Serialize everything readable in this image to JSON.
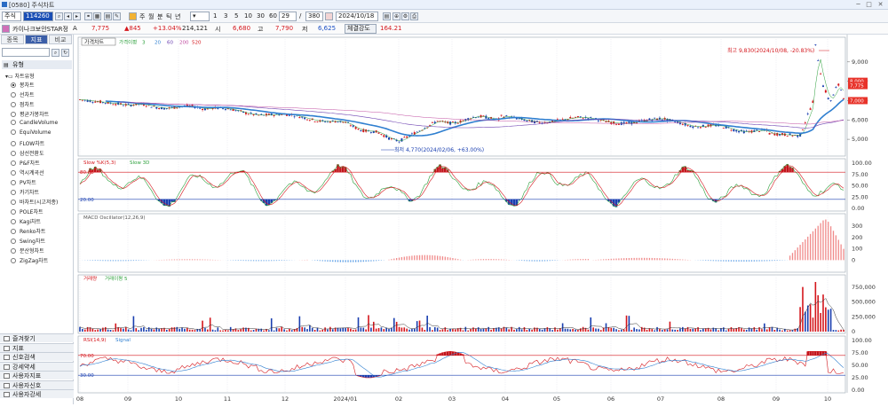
{
  "window": {
    "title": "[0580] 주식차트"
  },
  "toolbar": {
    "market": "주식",
    "code": "114260",
    "btn1": "1",
    "btn3": "3",
    "btn5": "5",
    "btn10": "10",
    "btn30": "30",
    "btn60": "60",
    "periods": [
      "주",
      "월",
      "분",
      "틱",
      "년"
    ],
    "count": "29",
    "count_total": "380",
    "date": "2024/10/18"
  },
  "quote": {
    "name": "카이나크보안STAR정",
    "flag": "A",
    "price": "7,775",
    "change": "▲845",
    "pct": "+13.04%",
    "volume": "214,121",
    "high_label": "시",
    "high": "6,680",
    "low_label": "고",
    "low": "7,790",
    "open_label": "저",
    "open": "6,625",
    "strength_label": "체결강도",
    "strength": "164.21"
  },
  "side": {
    "tabs": [
      "종목",
      "지표",
      "비교"
    ],
    "section": "유형",
    "group": "차트유형",
    "items": [
      "봉차트",
      "선차트",
      "점차트",
      "평균가봉차트",
      "CandleVolume",
      "EquiVolume",
      "FLOW차트",
      "삼선전환도",
      "P&F차트",
      "역시계곡선",
      "PV차트",
      "카기차트",
      "바차트(시고저종)",
      "POLE차트",
      "Kagi차트",
      "Renko차트",
      "Swing차트",
      "분산형차트",
      "ZigZag차트"
    ],
    "bottom": [
      "즐겨찾기",
      "지표",
      "신호검색",
      "강세약세",
      "사용자지표",
      "사용자신호",
      "사용자강세"
    ]
  },
  "chart_data": [
    {
      "type": "line",
      "title": "가격차트",
      "legend": [
        "가격이평",
        "3",
        "20",
        "60",
        "200",
        "520"
      ],
      "y_ticks": [
        "9,000",
        "8,000",
        "7,000",
        "6,000",
        "5,000"
      ],
      "ylim": [
        4500,
        10000
      ],
      "price_badges": [
        "8,000",
        "7,775",
        "7,000"
      ],
      "annotations": {
        "max": "최고 9,830(2024/10/08, -20.83%)",
        "min": "최저 4,770(2024/02/06, +63.00%)"
      }
    },
    {
      "type": "line",
      "title": "Slow %K(5,3) Slow %D",
      "legend": [
        "Slow %K(5,3)",
        "Slow 3D"
      ],
      "y_ticks": [
        "100.00",
        "75.00",
        "50.00",
        "25.00",
        "0.00"
      ],
      "levels": [
        "80.00",
        "20.00"
      ],
      "ylim": [
        0,
        100
      ]
    },
    {
      "type": "bar",
      "title": "MACD Oscillator(12,26,9)",
      "legend": [
        "MACD Oscillator(12,26,9)"
      ],
      "y_ticks": [
        "300",
        "200",
        "100",
        "0"
      ],
      "ylim": [
        -60,
        380
      ]
    },
    {
      "type": "bar",
      "title": "거래량",
      "legend": [
        "거래량",
        "거래이평 5"
      ],
      "y_ticks": [
        "750,000",
        "500,000",
        "250,000",
        "0"
      ],
      "ylim": [
        0,
        900000
      ]
    },
    {
      "type": "area",
      "title": "RSI(14,9) Signal",
      "legend": [
        "RSI(14,9)",
        "Signal"
      ],
      "y_ticks": [
        "100.00",
        "75.00",
        "50.00",
        "25.00",
        "0.00"
      ],
      "levels": [
        "70.00",
        "30.00"
      ],
      "ylim": [
        0,
        100
      ]
    }
  ],
  "x_axis": {
    "ticks": [
      "08",
      "09",
      "10",
      "11",
      "12",
      "2024/01",
      "02",
      "03",
      "04",
      "05",
      "06",
      "07",
      "08",
      "09",
      "10"
    ]
  }
}
